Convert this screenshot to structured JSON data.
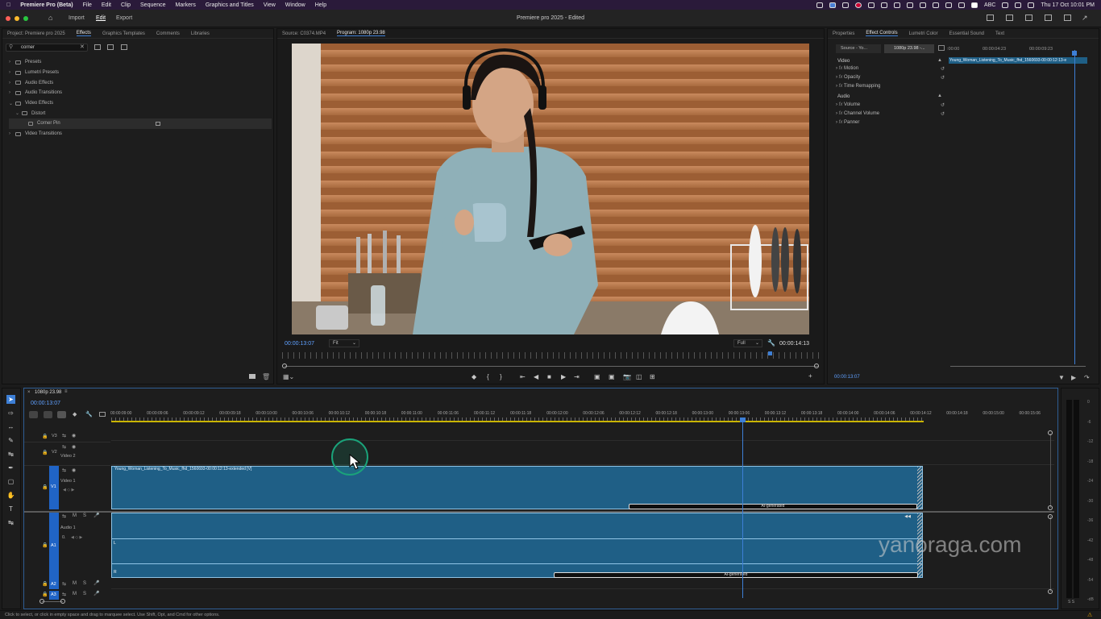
{
  "menubar": {
    "app": "Premiere Pro (Beta)",
    "items": [
      "File",
      "Edit",
      "Clip",
      "Sequence",
      "Markers",
      "Graphics and Titles",
      "View",
      "Window",
      "Help"
    ],
    "abc": "ABC",
    "datetime": "Thu 17 Oct  10:01 PM"
  },
  "header": {
    "nav": [
      "Import",
      "Edit",
      "Export"
    ],
    "title": "Premiere pro 2025 - Edited"
  },
  "project_panel": {
    "tabs": [
      "Project: Premiere pro 2025",
      "Effects",
      "Graphics Templates",
      "Comments",
      "Libraries"
    ],
    "search_value": "corner",
    "tree": [
      {
        "label": "Presets"
      },
      {
        "label": "Lumetri Presets"
      },
      {
        "label": "Audio Effects"
      },
      {
        "label": "Audio Transitions"
      },
      {
        "label": "Video Effects"
      },
      {
        "label": "Distort"
      },
      {
        "label": "Corner Pin"
      },
      {
        "label": "Video Transitions"
      }
    ]
  },
  "program": {
    "tabs": [
      "Source: C0374.MP4",
      "Program: 1080p 23.98"
    ],
    "timecode": "00:00:13:07",
    "fit": "Fit",
    "quality": "Full",
    "duration": "00:00:14:13"
  },
  "effect_controls": {
    "tabs": [
      "Properties",
      "Effect Controls",
      "Lumetri Color",
      "Essential Sound",
      "Text"
    ],
    "source": "Source - Yo...",
    "sequence": "1080p 23.98 -...",
    "ruler": [
      ":00:00",
      "00:00:04:23",
      "00:00:09:23"
    ],
    "clip": "Young_Woman_Listening_To_Music_fhd_1560693-00:00:12:13-e",
    "video_header": "Video",
    "video_props": [
      "Motion",
      "Opacity",
      "Time Remapping"
    ],
    "audio_header": "Audio",
    "audio_props": [
      "Volume",
      "Channel Volume",
      "Panner"
    ],
    "timecode": "00:00:13:07"
  },
  "timeline": {
    "tab": "1080p 23.98",
    "timecode": "00:00:13:07",
    "ruler": [
      "00:00:09:00",
      "00:00:09:06",
      "00:00:09:12",
      "00:00:09:18",
      "00:00:10:00",
      "00:00:10:06",
      "00:00:10:12",
      "00:00:10:18",
      "00:00:11:00",
      "00:00:11:06",
      "00:00:11:12",
      "00:00:11:18",
      "00:00:12:00",
      "00:00:12:06",
      "00:00:12:12",
      "00:00:12:18",
      "00:00:13:00",
      "00:00:13:06",
      "00:00:13:12",
      "00:00:13:18",
      "00:00:14:00",
      "00:00:14:06",
      "00:00:14:12",
      "00:00:14:18",
      "00:00:15:00",
      "00:00:15:06"
    ],
    "tracks": {
      "v3": "V3",
      "v2": "V2",
      "v2_name": "Video 2",
      "v1": "V1",
      "v1_name": "Video 1",
      "a1": "A1",
      "a1_name": "Audio 1",
      "a1_vol": "0.",
      "a2": "A2",
      "a3": "A3"
    },
    "video_clip": "Young_Woman_Listening_To_Music_fhd_1560693-00:00:12:13-extended [V]",
    "ai_label": "AI-generated",
    "audio_L": "L",
    "audio_R": "R",
    "meter_scale": [
      "0",
      "-6",
      "-12",
      "-18",
      "-24",
      "-30",
      "-36",
      "-42",
      "-48",
      "-54",
      "-dB"
    ],
    "meter_solo": "S S"
  },
  "watermark": "yanoraga.com",
  "status": "Click to select, or click in empty space and drag to marquee select. Use Shift, Opt, and Cmd for other options."
}
